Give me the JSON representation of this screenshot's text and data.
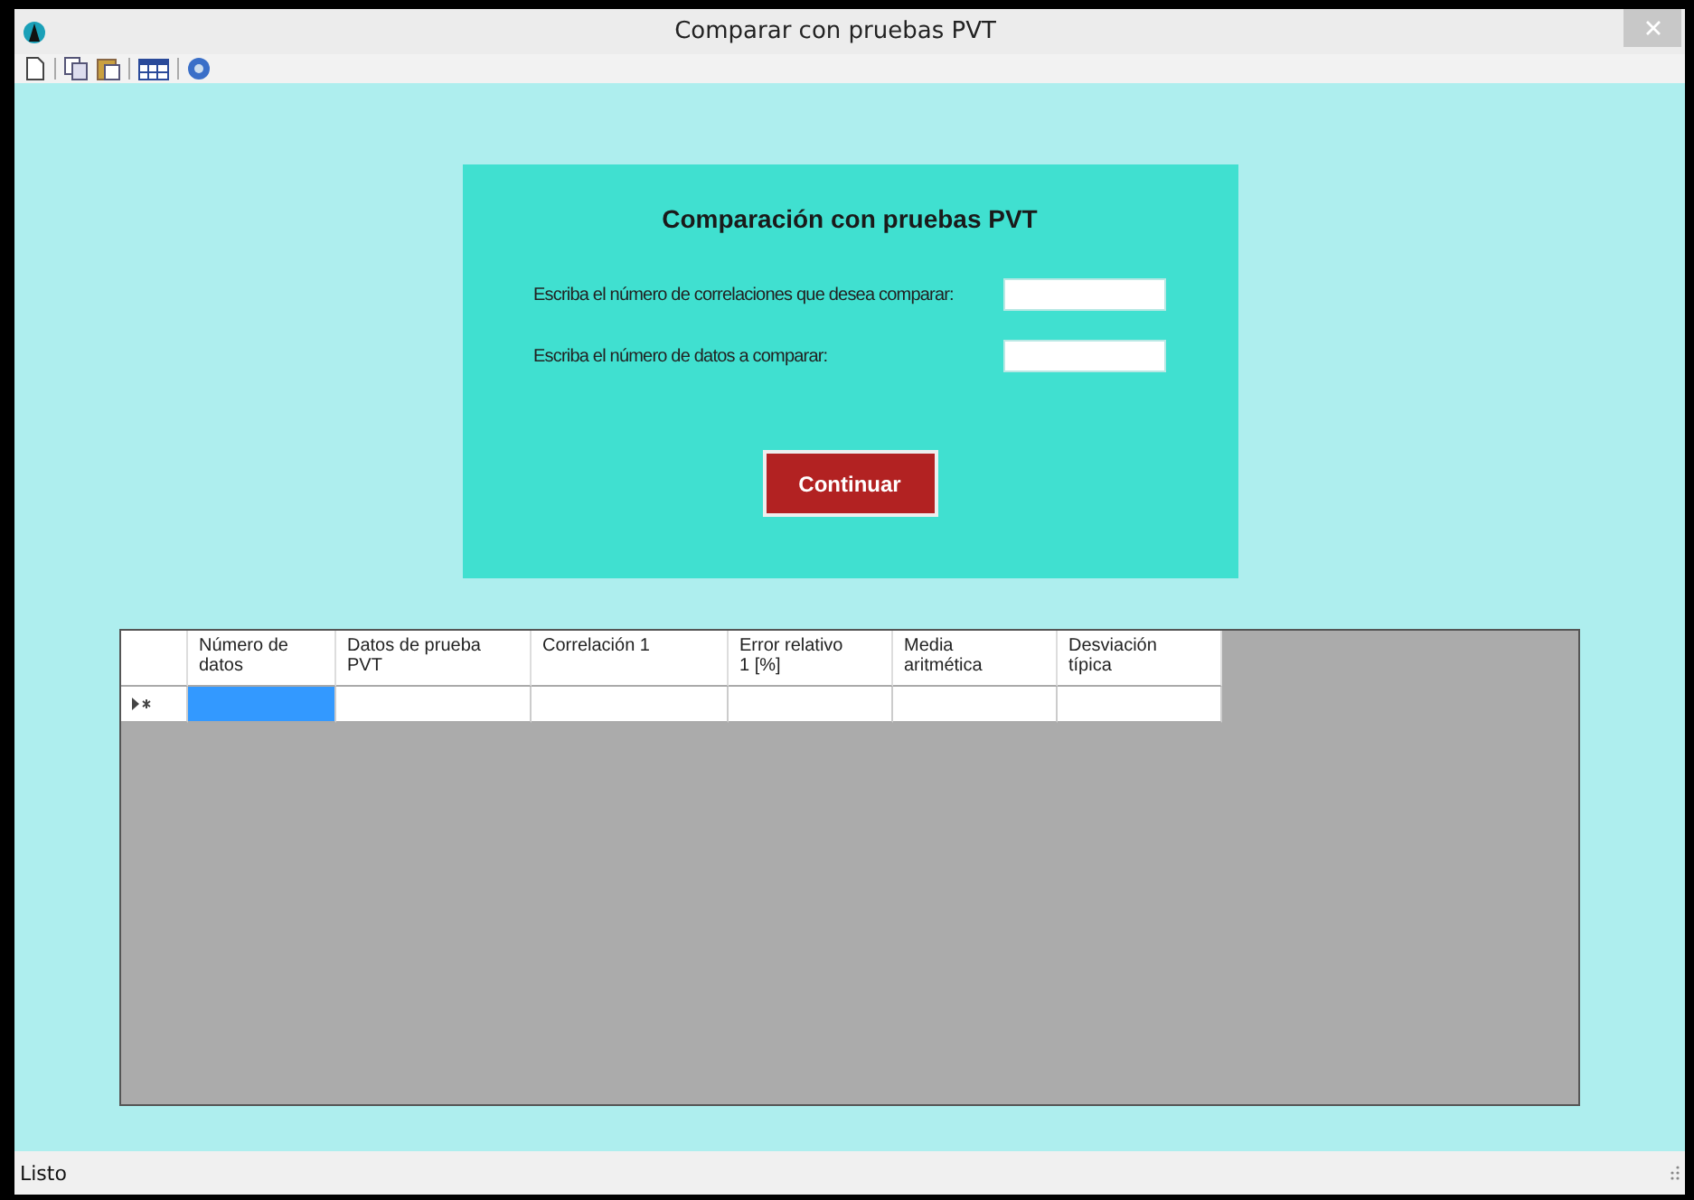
{
  "window": {
    "title": "Comparar con pruebas PVT"
  },
  "toolbar": {
    "buttons": [
      {
        "kind": "new"
      },
      {
        "kind": "separator"
      },
      {
        "kind": "copy"
      },
      {
        "kind": "paste"
      },
      {
        "kind": "separator"
      },
      {
        "kind": "table"
      },
      {
        "kind": "separator"
      },
      {
        "kind": "help"
      }
    ]
  },
  "form": {
    "heading": "Comparación con pruebas PVT",
    "fields": [
      {
        "label": "Escriba el número de correlaciones que desea comparar:"
      },
      {
        "label": "Escriba el número de datos a comparar:"
      }
    ],
    "button": "Continuar"
  },
  "table": {
    "columns": [
      "Número de datos",
      "Datos de prueba PVT",
      "Correlación 1",
      "Error relativo 1 [%]",
      "Media aritmética",
      "Desviación típica"
    ],
    "rows": [
      {
        "new_row": true,
        "cells": [
          {
            "selected": true
          },
          {
            "selected": false
          },
          {
            "selected": false
          },
          {
            "selected": false
          },
          {
            "selected": false
          },
          {
            "selected": false
          }
        ]
      }
    ]
  },
  "status_bar": {
    "text": "Listo"
  }
}
